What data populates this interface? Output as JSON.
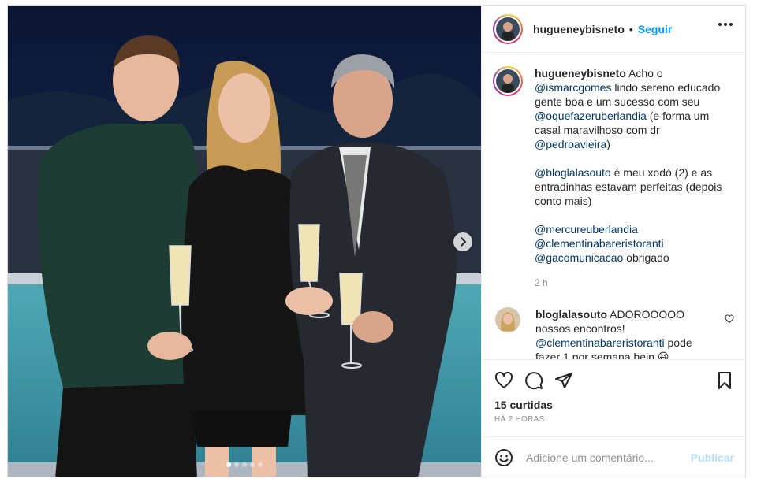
{
  "header": {
    "username": "hugueneybisneto",
    "separator": "•",
    "follow_label": "Seguir",
    "more_icon": "more-horizontal-icon"
  },
  "caption": {
    "username": "hugueneybisneto",
    "lines": [
      {
        "pre": " Acho o "
      },
      {
        "mention": "@ismarcgomes"
      },
      {
        "text": " lindo sereno educado gente boa e um sucesso com seu "
      },
      {
        "mention": "@oquefazeruberlandia"
      },
      {
        "text": " (e forma um casal maravilhoso com dr "
      },
      {
        "mention": "@pedroavieira"
      },
      {
        "text": ")"
      }
    ],
    "p2_mention": "@bloglalasouto",
    "p2_text": " é meu xodó (2) e as entradinhas estavam perfeitas (depois conto mais)",
    "p3_mention1": "@mercureuberlandia",
    "p3_mention2": "@clementinabareristoranti",
    "p3_mention3": "@gacomunicacao",
    "p3_text": " obrigado",
    "time": "2 h"
  },
  "comment": {
    "username": "bloglalasouto",
    "text1": " ADOROOOOO nossos encontros! ",
    "mention": "@clementinabareristoranti",
    "text2": " pode fazer 1 por semana hein 😆"
  },
  "actions": {
    "icons": [
      "heart-icon",
      "comment-icon",
      "share-icon",
      "bookmark-icon"
    ],
    "likes": "15 curtidas",
    "ago": "HÁ 2 HORAS"
  },
  "add_comment": {
    "placeholder": "Adicione um comentário...",
    "publish_label": "Publicar",
    "emoji_icon": "emoji-icon"
  },
  "carousel": {
    "total_slides": 5,
    "active_slide": 1,
    "next_icon": "chevron-right-icon"
  },
  "colors": {
    "link": "#0095f6",
    "mention": "#00376b",
    "publish_disabled": "#b2dffc",
    "muted": "#8e8e8e"
  }
}
